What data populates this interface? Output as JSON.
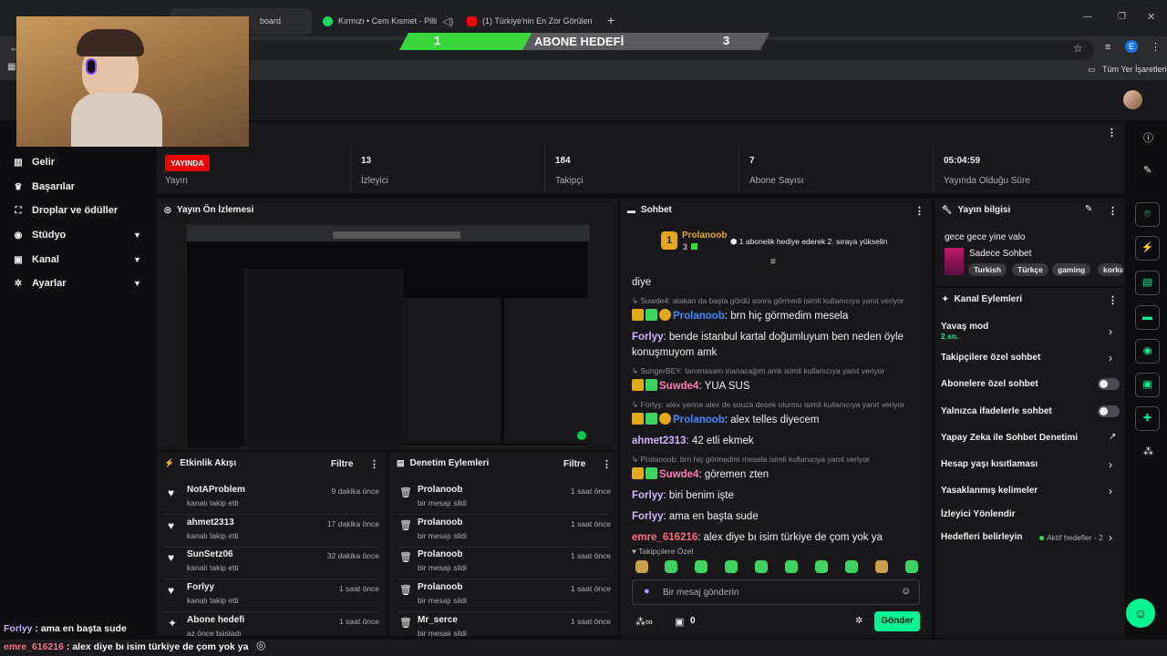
{
  "browser": {
    "tabs": [
      {
        "label": "board",
        "active": true
      },
      {
        "label": "Kırmızı • Cem Kısmet - Pilli",
        "active": false
      },
      {
        "label": "(1) Türkiye'nin En Zor Görülen",
        "active": false
      }
    ],
    "bookmarks_label": "Tüm Yer İşaretleri",
    "profile_initial": "E"
  },
  "overlay": {
    "goal_title": "ABONE HEDEFİ",
    "goal_current": "1",
    "goal_target": "3",
    "goal_progress": 0.333,
    "bottom_chat": [
      {
        "user": "Forlyy",
        "text": " : ama en başta sude",
        "color": "#d2b2ff"
      },
      {
        "user": "emre_616216",
        "text": " : alex diye bı isim türkiye de çom yok ya",
        "color": "#ff7a8a"
      }
    ]
  },
  "sidebar": {
    "items": [
      {
        "label": "Gelir",
        "icon": "chart-icon",
        "chevron": false
      },
      {
        "label": "Başarılar",
        "icon": "trophy-icon",
        "chevron": false
      },
      {
        "label": "Droplar ve ödüller",
        "icon": "gift-icon",
        "chevron": false
      },
      {
        "label": "Stüdyo",
        "icon": "studio-icon",
        "chevron": true
      },
      {
        "label": "Kanal",
        "icon": "channel-icon",
        "chevron": true
      },
      {
        "label": "Ayarlar",
        "icon": "gear-icon",
        "chevron": true
      }
    ]
  },
  "stats": {
    "live_badge": "YAYINDA",
    "live_label": "Yayın",
    "items": [
      {
        "value": "13",
        "label": "İzleyici"
      },
      {
        "value": "184",
        "label": "Takipçi"
      },
      {
        "value": "7",
        "label": "Abone Sayısı"
      },
      {
        "value": "05:04:59",
        "label": "Yayında Olduğu Süre"
      }
    ]
  },
  "preview": {
    "title": "Yayın Ön İzlemesi"
  },
  "activity": {
    "title": "Etkinlik Akışı",
    "filter": "Filtre",
    "items": [
      {
        "user": "NotAProblem",
        "action": "kanalı takip etti",
        "time": "9 dakika önce",
        "icon": "heart-icon"
      },
      {
        "user": "ahmet2313",
        "action": "kanalı takip etti",
        "time": "17 dakika önce",
        "icon": "heart-icon"
      },
      {
        "user": "SunSetz06",
        "action": "kanalı takip etti",
        "time": "32 dakika önce",
        "icon": "heart-icon"
      },
      {
        "user": "Forlyy",
        "action": "kanalı takip etti",
        "time": "1 saat önce",
        "icon": "heart-icon"
      },
      {
        "user": "Abone hedefi",
        "action": "az önce başladı",
        "time": "1 saat önce",
        "icon": "sparkle-icon"
      }
    ]
  },
  "moderation": {
    "title": "Denetim Eylemleri",
    "filter": "Filtre",
    "items": [
      {
        "user": "Prolanoob",
        "action": "bir mesajı sildi",
        "time": "1 saat önce"
      },
      {
        "user": "Prolanoob",
        "action": "bir mesajı sildi",
        "time": "1 saat önce"
      },
      {
        "user": "Prolanoob",
        "action": "bir mesajı sildi",
        "time": "1 saat önce"
      },
      {
        "user": "Prolanoob",
        "action": "bir mesajı sildi",
        "time": "1 saat önce"
      },
      {
        "user": "Mr_serce",
        "action": "bir mesajı sildi",
        "time": "1 saat önce"
      }
    ]
  },
  "chat": {
    "title": "Sohbet",
    "pinned": {
      "user": "Prolanoob",
      "count": "3",
      "rank": "1",
      "text": "1 abonelik hediye ederek 2. sıraya yükselin"
    },
    "partial_top": "diye",
    "messages": [
      {
        "reply": "Suwde4: atakan da başta gördü sonra görmedi isimli kullanıcıya yanıt veriyor",
        "user": "Prolanoob",
        "color": "#3d8bff",
        "badges": [
          "crown",
          "gift",
          "one"
        ],
        "text": ": brn hiç görmedim mesela"
      },
      {
        "reply": "",
        "user": "Forlyy",
        "color": "#d2b2ff",
        "badges": [],
        "text": ": bende istanbul kartal doğumluyum ben neden öyle konuşmuyom amk"
      },
      {
        "reply": "SungerBEY: tanımasam inanacağım amk isimli kullanıcıya yanıt veriyor",
        "user": "Suwde4",
        "color": "#ff7ab8",
        "badges": [
          "crown",
          "gift"
        ],
        "text": ": YUA SUS"
      },
      {
        "reply": "Forlyy: alex yerine alex de souza desek olurmu isimli kullanıcıya yanıt veriyor",
        "user": "Prolanoob",
        "color": "#3d8bff",
        "badges": [
          "crown",
          "gift",
          "one"
        ],
        "text": ": alex telles diyecem"
      },
      {
        "reply": "",
        "user": "ahmet2313",
        "color": "#d2b2ff",
        "badges": [],
        "text": ": 42 etli ekmek"
      },
      {
        "reply": "Prolanoob: brn hiç görmedim mesela isimli kullanıcıya yanıt veriyor",
        "user": "Suwde4",
        "color": "#ff7ab8",
        "badges": [
          "crown",
          "gift"
        ],
        "text": ": göremen zten"
      },
      {
        "reply": "",
        "user": "Forlyy",
        "color": "#d2b2ff",
        "badges": [],
        "text": ": biri benim işte"
      },
      {
        "reply": "",
        "user": "Forlyy",
        "color": "#d2b2ff",
        "badges": [],
        "text": ": ama en başta sude"
      },
      {
        "reply": "",
        "user": "emre_616216",
        "color": "#ff6b7f",
        "badges": [],
        "text": ": alex diye bı isim türkiye de çom yok ya"
      }
    ],
    "emote_section": "Takipçilere Özel",
    "input_placeholder": "Bir mesaj gönderin",
    "points": "0",
    "send": "Gönder"
  },
  "stream_info": {
    "title_label": "Yayın bilgisi",
    "stream_title": "gece gece yine valo",
    "category": "Sadece Sohbet",
    "tags": [
      "Turkish",
      "Türkçe",
      "gaming",
      "korku"
    ]
  },
  "channel_actions": {
    "title": "Kanal Eylemleri",
    "items": [
      {
        "label": "Yavaş mod",
        "sub": "2 sn.",
        "control": "chevron"
      },
      {
        "label": "Takipçilere özel sohbet",
        "sub": "",
        "control": "chevron"
      },
      {
        "label": "Abonelere özel sohbet",
        "sub": "",
        "control": "toggle"
      },
      {
        "label": "Yalnızca ifadelerle sohbet",
        "sub": "",
        "control": "toggle"
      },
      {
        "label": "Yapay Zeka ile Sohbet Denetimi",
        "sub": "",
        "control": "external"
      },
      {
        "label": "Hesap yaşı kısıtlaması",
        "sub": "",
        "control": "chevron"
      },
      {
        "label": "Yasaklanmış kelimeler",
        "sub": "",
        "control": "chevron"
      },
      {
        "label": "İzleyici Yönlendir",
        "sub": "",
        "control": "none"
      },
      {
        "label": "Hedefleri belirleyin",
        "sub": "",
        "control": "chevron",
        "extra": "Aktif hedefler - 2"
      }
    ]
  },
  "colors": {
    "accent": "#00f593",
    "live": "#eb0400",
    "goal_green": "#3bd63b"
  }
}
